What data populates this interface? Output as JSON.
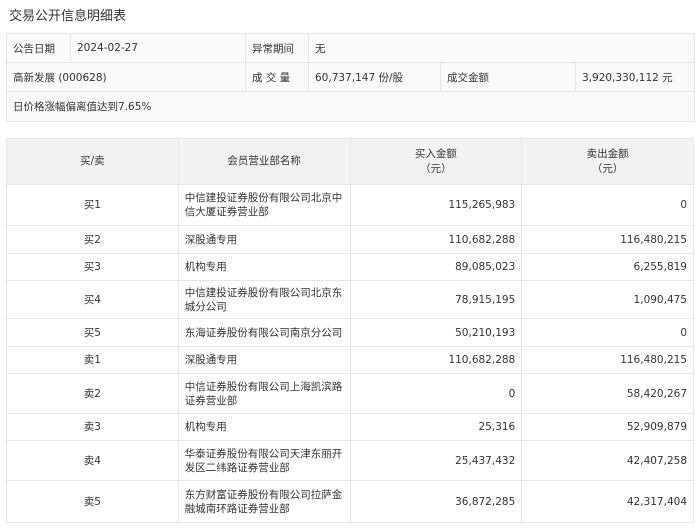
{
  "title": "交易公开信息明细表",
  "info": {
    "date_label": "公告日期",
    "date": "2024-02-27",
    "period_label": "异常期间",
    "period": "无",
    "stock": "高新发展 (000628)",
    "volume_label": "成 交 量",
    "volume": "60,737,147 份/股",
    "amount_label": "成交金额",
    "amount": "3,920,330,112 元",
    "reason": "日价格涨幅偏离值达到7.65%"
  },
  "table": {
    "headers": [
      "买/卖",
      "会员营业部名称",
      "买入金额\n（元）",
      "卖出金额\n（元）"
    ],
    "rows": [
      {
        "side": "买1",
        "name": "中信建投证券股份有限公司北京中信大厦证券营业部",
        "buy": "115,265,983",
        "sell": "0"
      },
      {
        "side": "买2",
        "name": "深股通专用",
        "buy": "110,682,288",
        "sell": "116,480,215"
      },
      {
        "side": "买3",
        "name": "机构专用",
        "buy": "89,085,023",
        "sell": "6,255,819"
      },
      {
        "side": "买4",
        "name": "中信建投证券股份有限公司北京东城分公司",
        "buy": "78,915,195",
        "sell": "1,090,475"
      },
      {
        "side": "买5",
        "name": "东海证券股份有限公司南京分公司",
        "buy": "50,210,193",
        "sell": "0"
      },
      {
        "side": "卖1",
        "name": "深股通专用",
        "buy": "110,682,288",
        "sell": "116,480,215"
      },
      {
        "side": "卖2",
        "name": "中信证券股份有限公司上海凯滨路证券营业部",
        "buy": "0",
        "sell": "58,420,267"
      },
      {
        "side": "卖3",
        "name": "机构专用",
        "buy": "25,316",
        "sell": "52,909,879"
      },
      {
        "side": "卖4",
        "name": "华泰证券股份有限公司天津东丽开发区二纬路证券营业部",
        "buy": "25,437,432",
        "sell": "42,407,258"
      },
      {
        "side": "卖5",
        "name": "东方财富证券股份有限公司拉萨金融城南环路证券营业部",
        "buy": "36,872,285",
        "sell": "42,317,404"
      }
    ]
  }
}
